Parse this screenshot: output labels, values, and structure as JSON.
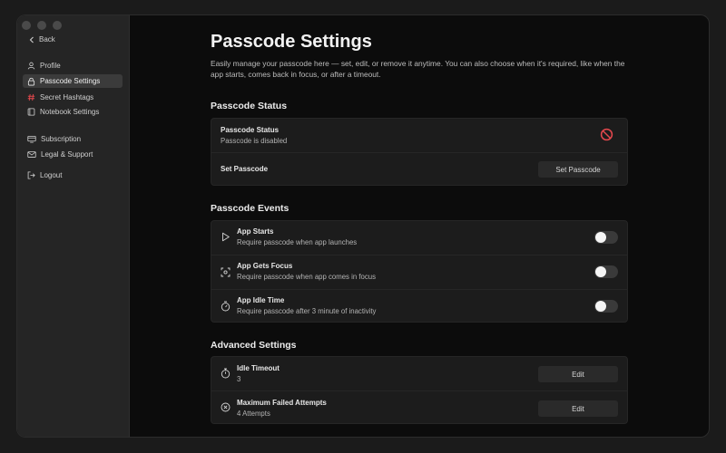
{
  "sidebar": {
    "back_label": "Back",
    "items": [
      {
        "label": "Profile",
        "icon": "user-icon"
      },
      {
        "label": "Passcode Settings",
        "icon": "lock-icon",
        "active": true
      },
      {
        "label": "Secret Hashtags",
        "icon": "hashtag-icon"
      },
      {
        "label": "Notebook Settings",
        "icon": "notebook-icon"
      },
      {
        "label": "Subscription",
        "icon": "card-icon"
      },
      {
        "label": "Legal & Support",
        "icon": "mail-icon"
      },
      {
        "label": "Logout",
        "icon": "logout-icon"
      }
    ]
  },
  "page": {
    "title": "Passcode Settings",
    "description": "Easily manage your passcode here — set, edit, or remove it anytime. You can also choose when it's required, like when the app starts, comes back in focus, or after a timeout."
  },
  "status_section": {
    "title": "Passcode Status",
    "status_label": "Passcode Status",
    "status_value": "Passcode is disabled",
    "status_icon": "disabled-icon",
    "status_icon_color": "#e5484d",
    "set_label": "Set Passcode",
    "set_button": "Set Passcode"
  },
  "events_section": {
    "title": "Passcode Events",
    "events": [
      {
        "title": "App Starts",
        "subtitle": "Require passcode when app launches",
        "icon": "play-icon",
        "enabled": false
      },
      {
        "title": "App Gets Focus",
        "subtitle": "Require passcode when app comes in focus",
        "icon": "focus-icon",
        "enabled": false
      },
      {
        "title": "App Idle Time",
        "subtitle": "Require passcode after 3 minute of inactivity",
        "icon": "timer-icon",
        "enabled": false
      }
    ]
  },
  "advanced_section": {
    "title": "Advanced Settings",
    "items": [
      {
        "title": "Idle Timeout",
        "value": "3",
        "button": "Edit",
        "icon": "stopwatch-icon"
      },
      {
        "title": "Maximum Failed Attempts",
        "value": "4 Attempts",
        "button": "Edit",
        "icon": "x-circle-icon"
      }
    ]
  }
}
